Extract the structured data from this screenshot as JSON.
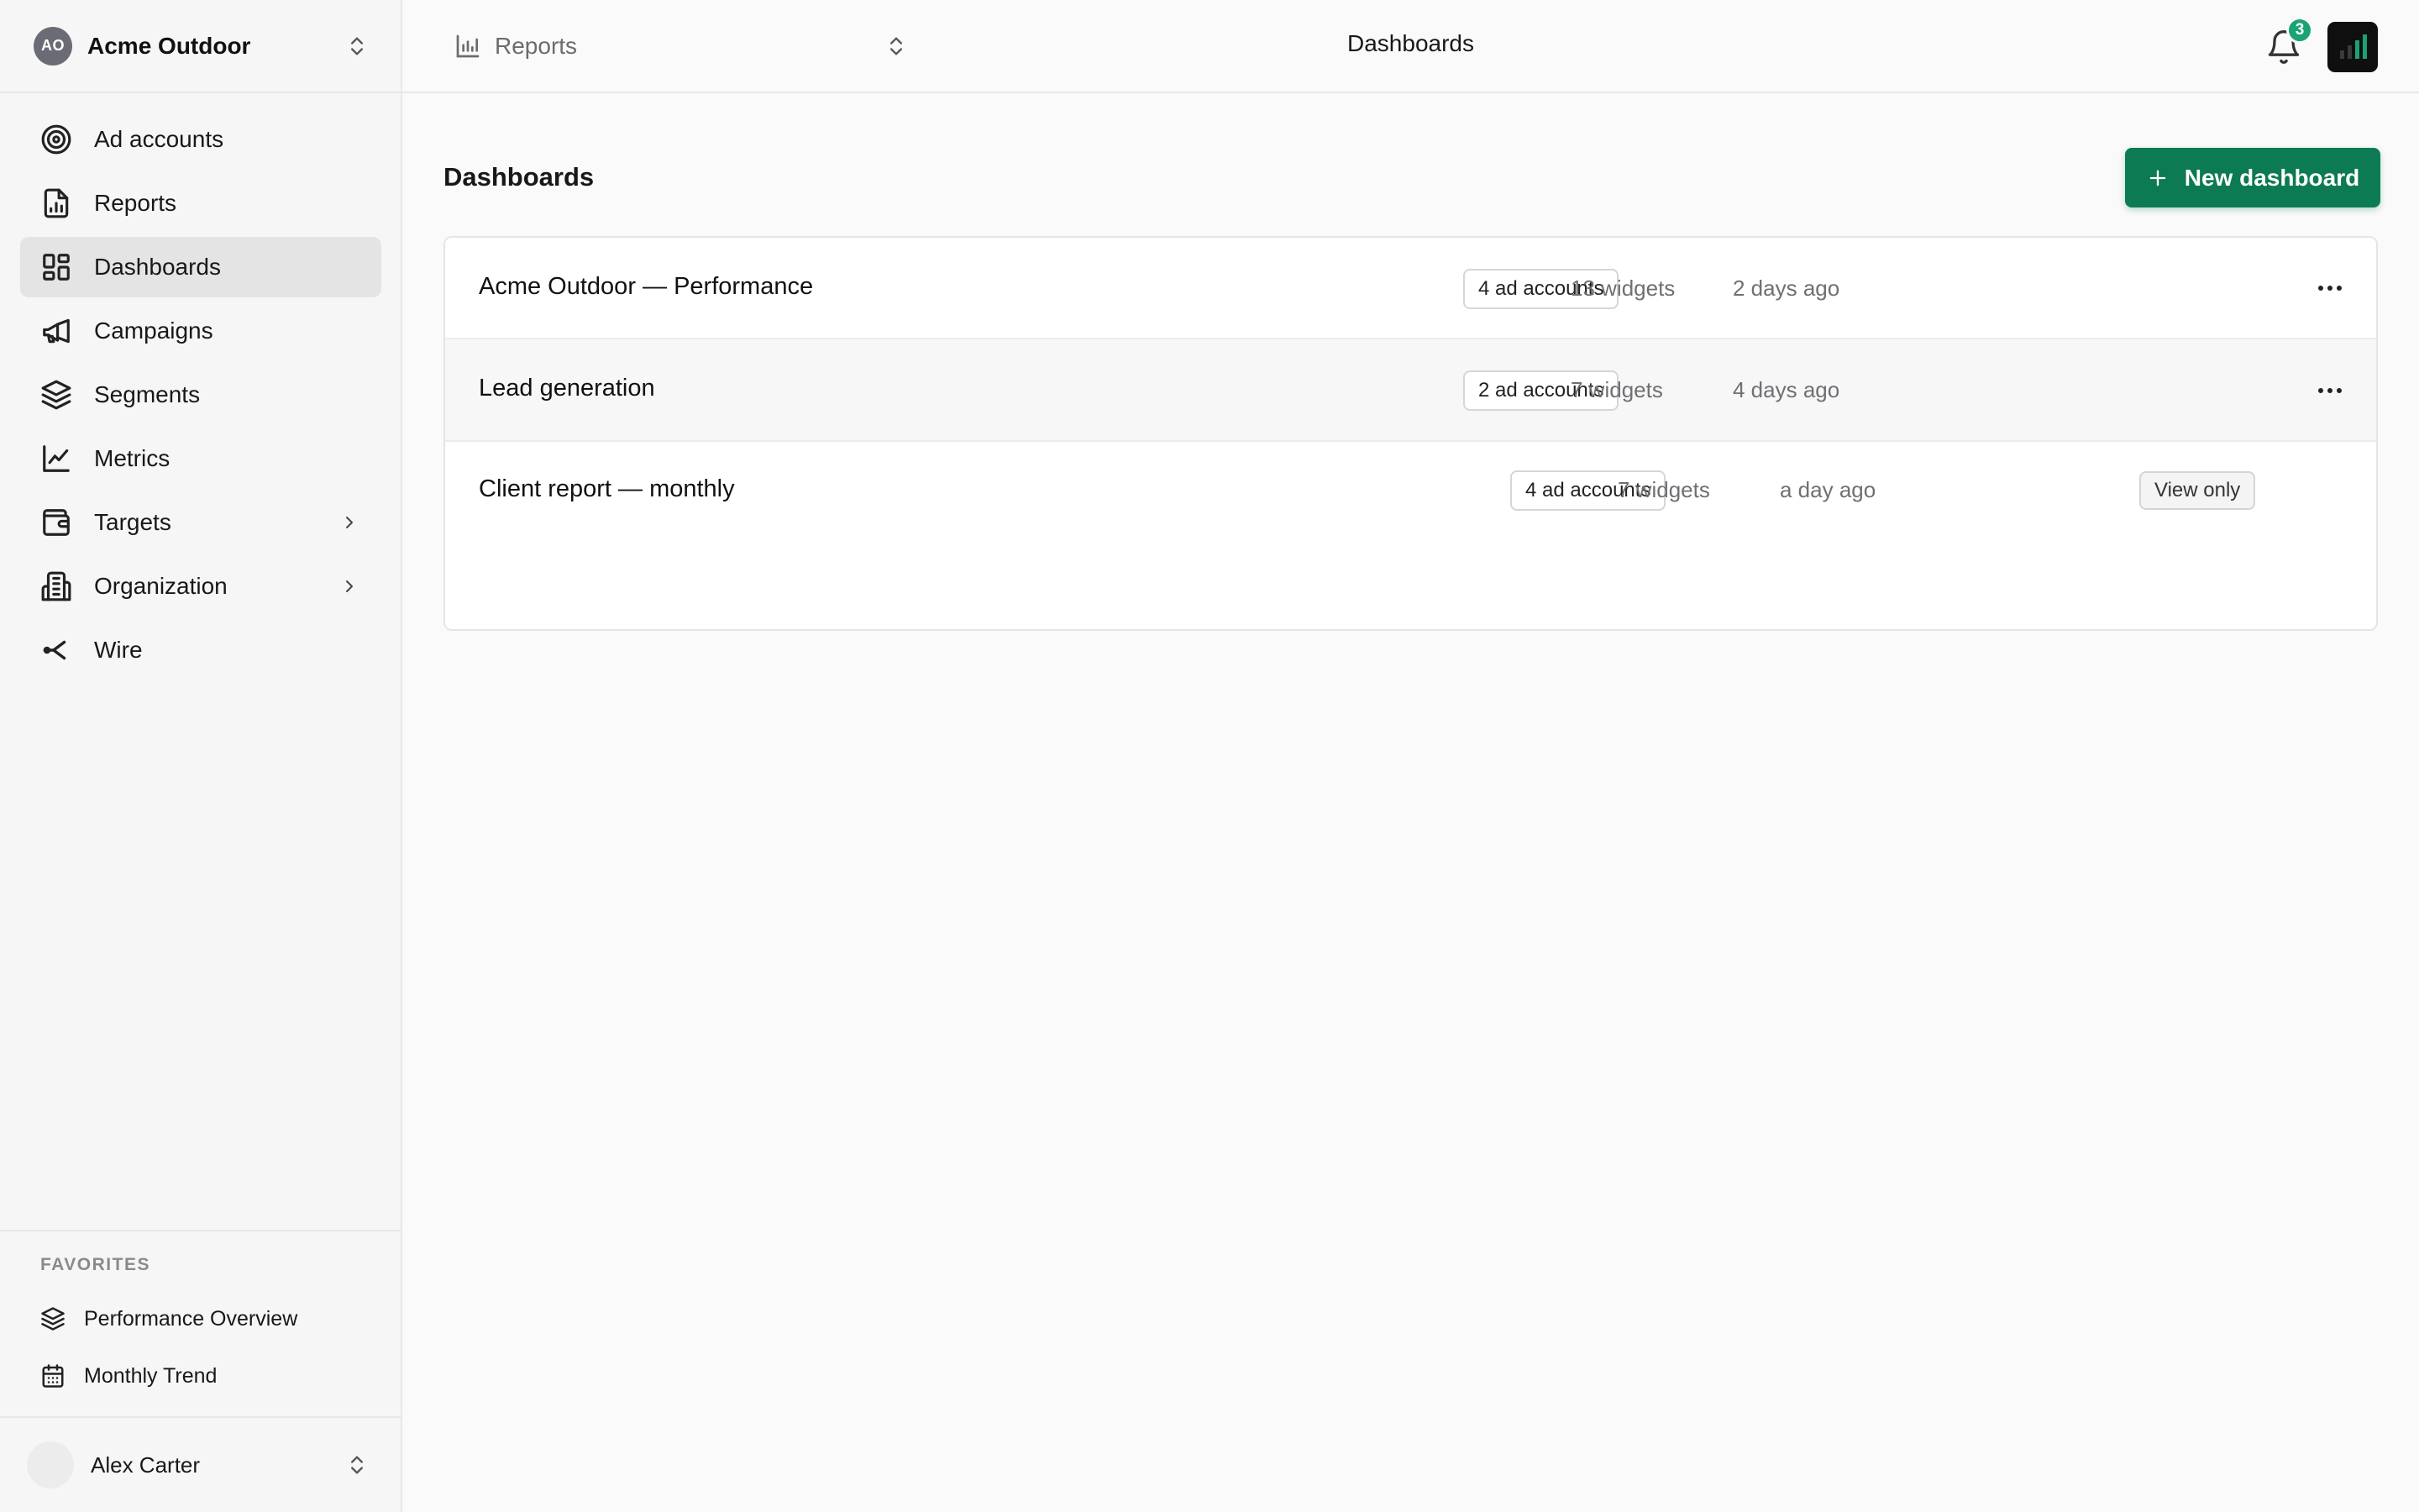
{
  "org": {
    "initials": "AO",
    "name": "Acme Outdoor"
  },
  "sidebar": {
    "items": [
      {
        "label": "Ad accounts"
      },
      {
        "label": "Reports"
      },
      {
        "label": "Dashboards"
      },
      {
        "label": "Campaigns"
      },
      {
        "label": "Segments"
      },
      {
        "label": "Metrics"
      },
      {
        "label": "Targets"
      },
      {
        "label": "Organization"
      },
      {
        "label": "Wire"
      }
    ]
  },
  "favorites": {
    "title": "FAVORITES",
    "items": [
      {
        "label": "Performance Overview",
        "icon": "layers-icon"
      },
      {
        "label": "Monthly Trend",
        "icon": "calendar-icon"
      }
    ]
  },
  "user": {
    "name": "Alex Carter"
  },
  "topbar": {
    "report_switcher": "Reports",
    "title": "Dashboards",
    "notification_count": "3"
  },
  "main": {
    "title": "Dashboards",
    "new_button": "New dashboard",
    "rows": [
      {
        "name": "Acme Outdoor — Performance",
        "accounts": "4 ad accounts",
        "widgets": "13 widgets",
        "updated": "2 days ago"
      },
      {
        "name": "Lead generation",
        "accounts": "2 ad accounts",
        "widgets": "7 widgets",
        "updated": "4 days ago"
      },
      {
        "name": "Client report — monthly",
        "accounts": "4 ad accounts",
        "widgets": "7 widgets",
        "updated": "a day ago",
        "badge": "View only"
      }
    ]
  },
  "colors": {
    "accent": "#0c7a52",
    "badge": "#1aa374",
    "active_nav": "#e4e4e5"
  }
}
